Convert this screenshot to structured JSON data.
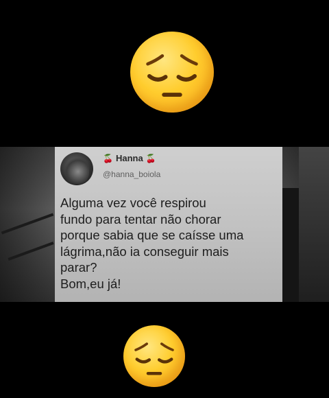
{
  "tweet": {
    "display_name": "Hanna",
    "name_decoration": "🍒",
    "handle": "@hanna_boiola",
    "text": "Alguma vez você respirou\nfundo para tentar não chorar\nporque sabia que se caísse uma\nlágrima,não ia conseguir mais\nparar?\nBom,eu já!"
  },
  "emojis": {
    "top": "pensive-face",
    "bottom": "pensive-face"
  },
  "colors": {
    "background": "#000000",
    "card": "#c6c6c6",
    "emoji": "#ffcd2e"
  }
}
